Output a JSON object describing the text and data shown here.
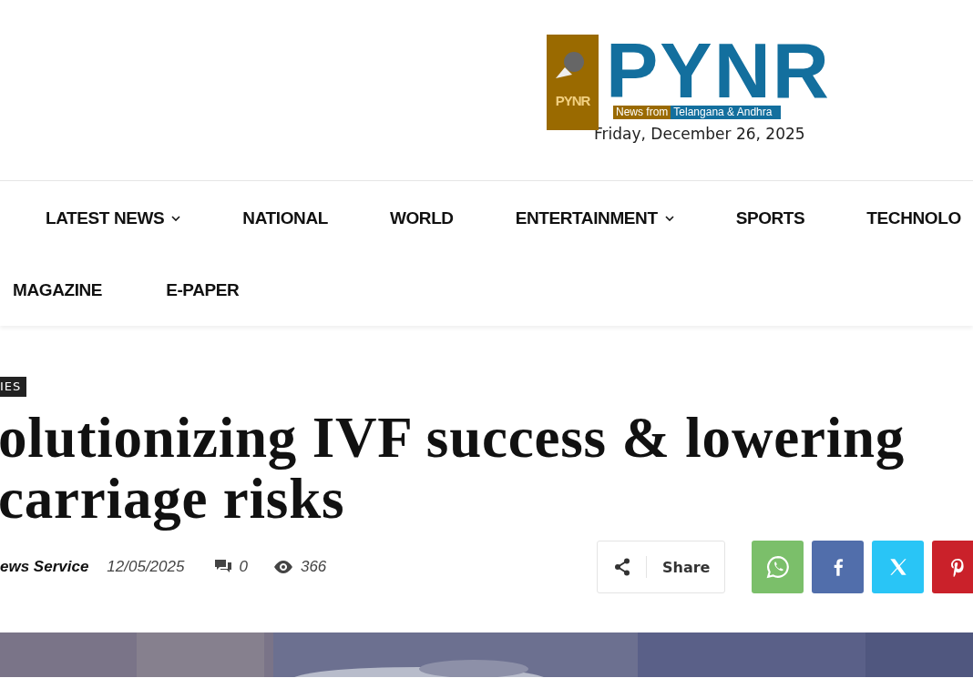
{
  "header": {
    "logo": {
      "mark_text": "PYNR",
      "name": "PYNR",
      "tagline_lead": "News from",
      "tagline_rest": "Telangana & Andhra"
    },
    "date": "Friday, December 26, 2025"
  },
  "nav": {
    "rows": [
      [
        {
          "label": "LATEST NEWS",
          "has_dropdown": true
        },
        {
          "label": "NATIONAL",
          "has_dropdown": false
        },
        {
          "label": "WORLD",
          "has_dropdown": false
        },
        {
          "label": "ENTERTAINMENT",
          "has_dropdown": true
        },
        {
          "label": "SPORTS",
          "has_dropdown": false
        },
        {
          "label": "TECHNOLO",
          "has_dropdown": false
        }
      ],
      [
        {
          "label": "MAGAZINE",
          "has_dropdown": false
        },
        {
          "label": "E-PAPER",
          "has_dropdown": false
        }
      ]
    ]
  },
  "article": {
    "category": "IES",
    "title_lines": [
      "olutionizing IVF success & lowering",
      "carriage risks"
    ],
    "author": "ews Service",
    "date": "12/05/2025",
    "comments": "0",
    "views": "366",
    "share": {
      "label": "Share",
      "buttons": [
        {
          "kind": "whatsapp",
          "color": "#7bbf6a"
        },
        {
          "kind": "facebook",
          "color": "#516eab"
        },
        {
          "kind": "x",
          "color": "#29c5f6"
        },
        {
          "kind": "pinterest",
          "color": "#ca212a"
        }
      ]
    }
  }
}
